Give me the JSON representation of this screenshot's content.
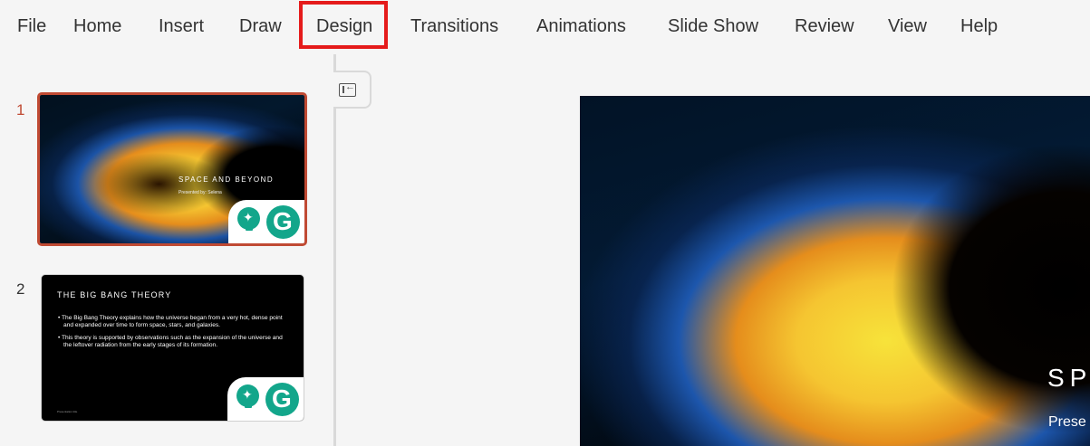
{
  "menu": {
    "items": [
      "File",
      "Home",
      "Insert",
      "Draw",
      "Design",
      "Transitions",
      "Animations",
      "Slide Show",
      "Review",
      "View",
      "Help"
    ],
    "highlighted": "Design",
    "highlight_color": "#e51b1b"
  },
  "thumbnails": [
    {
      "number": "1",
      "title": "SPACE AND BEYOND",
      "subtitle": "Presented by: Selena",
      "selected": true,
      "number_color": "#c04a33"
    },
    {
      "number": "2",
      "title": "THE BIG BANG THEORY",
      "bullets": [
        "• The Big Bang Theory explains how the universe began from a very hot, dense point and expanded over time to form space, stars, and galaxies.",
        "• This theory is supported by observations such as the expansion of the universe and the leftover radiation from the early stages of its formation."
      ],
      "footer": "Presentation title",
      "number_color": "#333333"
    }
  ],
  "badges": {
    "bulb_icon": "lightbulb-sparkle-icon",
    "g_icon": "grammarly-g-icon",
    "bulb_glyph": "✦",
    "g_glyph": "G",
    "color": "#13a68b"
  },
  "main_slide": {
    "title_visible": "SPA",
    "subtitle_visible": "Prese"
  }
}
